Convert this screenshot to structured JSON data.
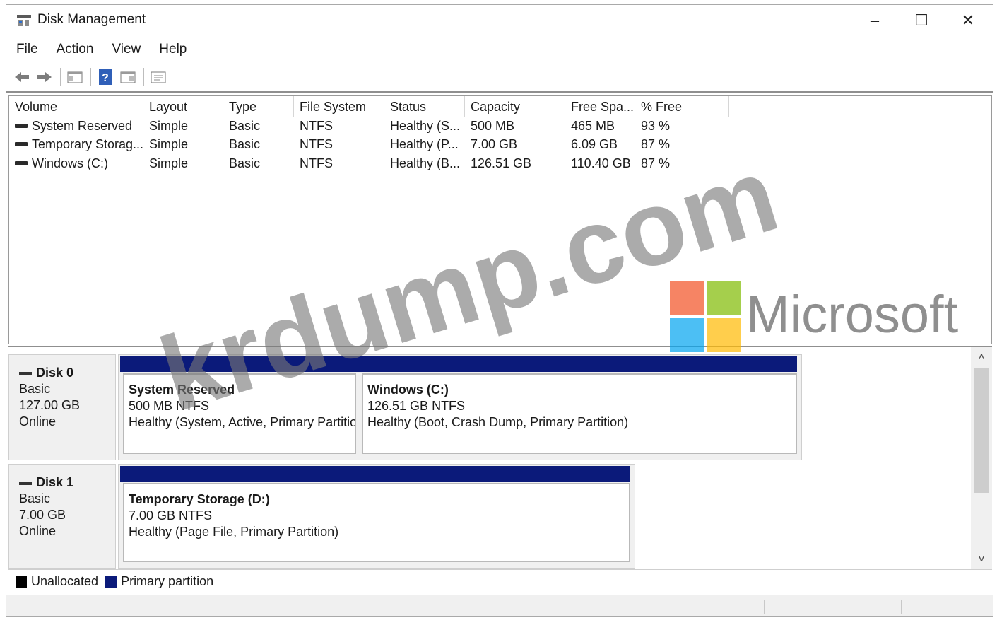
{
  "window": {
    "title": "Disk Management",
    "minimize_glyph": "–",
    "maximize_glyph": "☐",
    "close_glyph": "✕"
  },
  "menu": {
    "items": [
      {
        "label": "File"
      },
      {
        "label": "Action"
      },
      {
        "label": "View"
      },
      {
        "label": "Help"
      }
    ]
  },
  "toolbar": {
    "icons": [
      "back-arrow-icon",
      "forward-arrow-icon",
      "console-tree-icon",
      "help-icon",
      "properties-icon",
      "settings-list-icon"
    ]
  },
  "volume_list": {
    "columns": [
      "Volume",
      "Layout",
      "Type",
      "File System",
      "Status",
      "Capacity",
      "Free Spa...",
      "% Free"
    ],
    "rows": [
      {
        "volume": "System Reserved",
        "layout": "Simple",
        "type": "Basic",
        "fs": "NTFS",
        "status": "Healthy (S...",
        "capacity": "500 MB",
        "free": "465 MB",
        "pct": "93 %"
      },
      {
        "volume": "Temporary Storag...",
        "layout": "Simple",
        "type": "Basic",
        "fs": "NTFS",
        "status": "Healthy (P...",
        "capacity": "7.00 GB",
        "free": "6.09 GB",
        "pct": "87 %"
      },
      {
        "volume": "Windows (C:)",
        "layout": "Simple",
        "type": "Basic",
        "fs": "NTFS",
        "status": "Healthy (B...",
        "capacity": "126.51 GB",
        "free": "110.40 GB",
        "pct": "87 %"
      }
    ]
  },
  "disks": [
    {
      "name": "Disk 0",
      "type": "Basic",
      "size": "127.00 GB",
      "state": "Online",
      "partitions": [
        {
          "name": "System Reserved",
          "size_fs": "500 MB NTFS",
          "status": "Healthy (System, Active, Primary Partitio"
        },
        {
          "name": "Windows (C:)",
          "size_fs": "126.51 GB NTFS",
          "status": "Healthy (Boot, Crash Dump, Primary Partition)"
        }
      ]
    },
    {
      "name": "Disk 1",
      "type": "Basic",
      "size": "7.00 GB",
      "state": "Online",
      "partitions": [
        {
          "name": "Temporary Storage (D:)",
          "size_fs": "7.00 GB NTFS",
          "status": "Healthy (Page File, Primary Partition)"
        }
      ]
    }
  ],
  "legend": {
    "unallocated_label": "Unallocated",
    "unallocated_color": "#000000",
    "primary_label": "Primary partition",
    "primary_color": "#0b1a7a"
  },
  "scrollbar": {
    "up_glyph": "˄",
    "down_glyph": "˅"
  },
  "watermark": {
    "text": "krdump.com",
    "brand": "Microsoft",
    "logo_colors": [
      "#f25022",
      "#7fba00",
      "#00a4ef",
      "#ffb900"
    ]
  }
}
